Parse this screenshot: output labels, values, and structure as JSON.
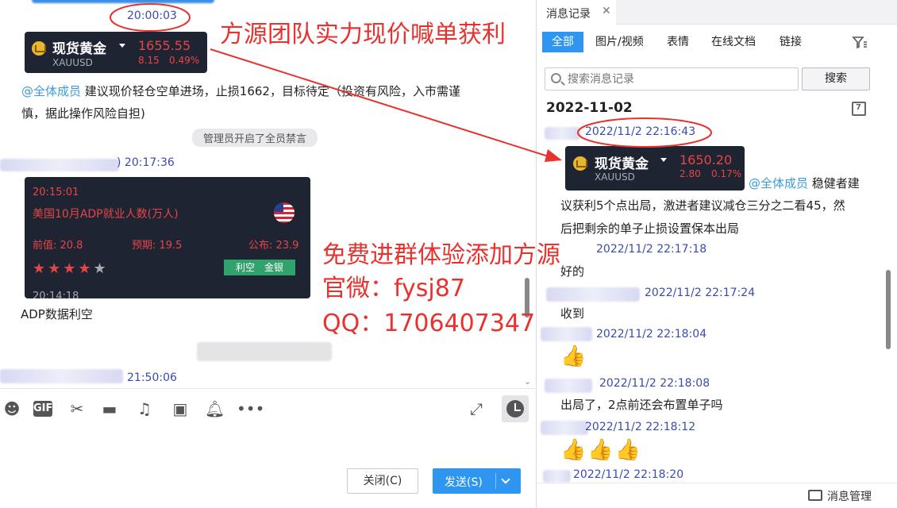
{
  "chat": {
    "time1": "20:00:03",
    "gold_card1": {
      "name": "现货黄金",
      "symbol": "XAUUSD",
      "price": "1655.55",
      "change": "8.15",
      "percent": "0.49%"
    },
    "msg1_mention": "@全体成员",
    "msg1_line1": " 建议现价轻仓空单进场，止损1662，目标待定（投资有风险，入市需谨",
    "msg1_line2": "慎，据此操作风险自担)",
    "system_notice": "管理员开启了全员禁言",
    "time2": ")  20:17:36",
    "adp_card": {
      "time": "20:15:01",
      "title": "美国10月ADP就业人数(万人)",
      "previous": "前值: 20.8",
      "forecast": "预期: 19.5",
      "actual": "公布: 23.9",
      "rating_stars": 4,
      "rating_max": 5,
      "tag": "利空　金银",
      "next_time": "20:14:18"
    },
    "msg2": "ADP数据利空",
    "time3": "21:50:06",
    "buttons": {
      "close": "关闭(C)",
      "send": "发送(S)"
    }
  },
  "promo": {
    "headline": "方源团队实力现价喊单获利",
    "line1": "免费进群体验添加方源",
    "line2": "官微：fysj87",
    "line3": "QQ：1706407347"
  },
  "history": {
    "tab_title": "消息记录",
    "filters": [
      "全部",
      "图片/视频",
      "表情",
      "在线文档",
      "链接"
    ],
    "search_placeholder": "搜索消息记录",
    "search_button": "搜索",
    "date": "2022-11-02",
    "gold_card2": {
      "name": "现货黄金",
      "symbol": "XAUUSD",
      "price": "1650.20",
      "change": "2.80",
      "percent": "0.17%"
    },
    "entries": [
      {
        "time": "2022/11/2 22:16:43"
      },
      {
        "time": "2022/11/2 22:17:18",
        "text": "好的"
      },
      {
        "time": "2022/11/2 22:17:24",
        "text": "收到"
      },
      {
        "time": "2022/11/2 22:18:04",
        "text": "👍"
      },
      {
        "time": "2022/11/2 22:18:08",
        "text": "出局了，2点前还会布置单子吗"
      },
      {
        "time": "2022/11/2 22:18:12",
        "text": "👍👍👍"
      },
      {
        "time": "2022/11/2 22:18:20"
      }
    ],
    "msg_mention": "@全体成员",
    "msg_line1": " 稳健者建",
    "msg_line2": "议获利5个点出局，激进者建议减仓三分之二看45，然",
    "msg_line3": "后把剩余的单子止损设置保本出局",
    "manage": "消息管理"
  },
  "colors": {
    "accent": "#2e95f0",
    "promo_red": "#e8322e",
    "timestamp": "#3a4bb0",
    "card_bg": "#1f2433"
  }
}
